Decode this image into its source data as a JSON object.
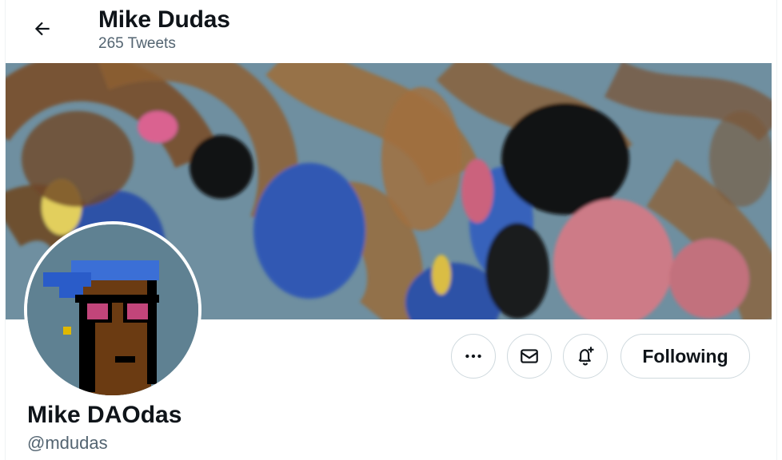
{
  "header": {
    "back_icon": "arrow-left-icon",
    "title": "Mike Dudas",
    "tweet_count": "265 Tweets"
  },
  "banner": {
    "description_colors": [
      "#6f8fa0",
      "#8a5a2b",
      "#2f56b5",
      "#0b0b0b",
      "#d37a86",
      "#e9d35a"
    ]
  },
  "profile": {
    "display_name": "Mike DAOdas",
    "handle": "@mdudas"
  },
  "actions": {
    "more_icon": "more-horizontal-icon",
    "message_icon": "envelope-icon",
    "notify_icon": "bell-plus-icon",
    "follow_label": "Following"
  },
  "colors": {
    "text_primary": "#0f1419",
    "text_secondary": "#536471",
    "border": "#cfd9de"
  }
}
